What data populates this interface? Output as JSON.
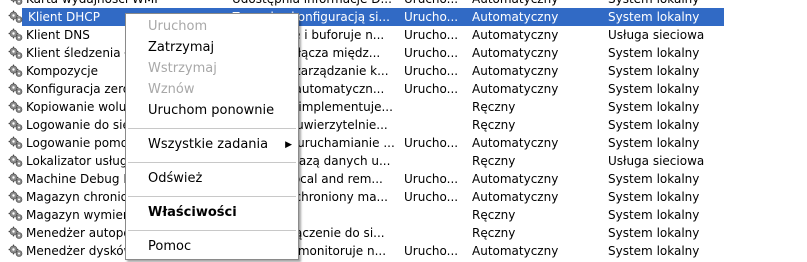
{
  "services": [
    {
      "name": "Karta wydajności WMI",
      "desc": "Udostępnia informacje D...",
      "status": "Urucho...",
      "startup": "Automatyczny",
      "logon": "System lokalny"
    },
    {
      "name": "Klient DHCP",
      "desc": "Zarządza konfiguracją si...",
      "status": "Urucho...",
      "startup": "Automatyczny",
      "logon": "System lokalny",
      "selected": true
    },
    {
      "name": "Klient DNS",
      "desc": "Rozpoznaje i buforuje n...",
      "status": "Urucho...",
      "startup": "Automatyczny",
      "logon": "Usługa sieciowa"
    },
    {
      "name": "Klient śledzenia łączy",
      "desc": "Utrzymuje łącza międz...",
      "status": "Urucho...",
      "startup": "Automatyczny",
      "logon": "System lokalny"
    },
    {
      "name": "Kompozycje",
      "desc": "Zapewnia zarządzanie k...",
      "status": "Urucho...",
      "startup": "Automatyczny",
      "logon": "System lokalny"
    },
    {
      "name": "Konfiguracja zerowej sieci",
      "desc": "Zapewnia automatyczn...",
      "status": "Urucho...",
      "startup": "Automatyczny",
      "logon": "System lokalny"
    },
    {
      "name": "Kopiowanie woluminów",
      "desc": "Zarządza i implementuje...",
      "status": "",
      "startup": "Ręczny",
      "logon": "System lokalny"
    },
    {
      "name": "Logowanie do sieci",
      "desc": "Obsługuje uwierzytelnie...",
      "status": "",
      "startup": "Ręczny",
      "logon": "System lokalny"
    },
    {
      "name": "Logowanie pomocnicze",
      "desc": "Umożliwia uruchamianie ...",
      "status": "Urucho...",
      "startup": "Automatyczny",
      "logon": "System lokalny"
    },
    {
      "name": "Lokalizator usługi RPC",
      "desc": "Zarządza bazą danych u...",
      "status": "",
      "startup": "Ręczny",
      "logon": "Usługa sieciowa"
    },
    {
      "name": "Machine Debug Manager",
      "desc": "Supports local and rem...",
      "status": "Urucho...",
      "startup": "Automatyczny",
      "logon": "System lokalny"
    },
    {
      "name": "Magazyn chroniony",
      "desc": "Zapewnia chroniony ma...",
      "status": "Urucho...",
      "startup": "Automatyczny",
      "logon": "System lokalny"
    },
    {
      "name": "Magazyn wymienny",
      "desc": "",
      "status": "",
      "startup": "Ręczny",
      "logon": "System lokalny"
    },
    {
      "name": "Menedżer autopołączeń",
      "desc": "Tworzy połączenie do si...",
      "status": "",
      "startup": "Ręczny",
      "logon": "System lokalny"
    },
    {
      "name": "Menedżer dysków logicznych",
      "desc": "Wykrywa i monitoruje n...",
      "status": "Urucho...",
      "startup": "Automatyczny",
      "logon": "System lokalny"
    }
  ],
  "context_menu": {
    "items": [
      {
        "label": "Uruchom",
        "disabled": true
      },
      {
        "label": "Zatrzymaj"
      },
      {
        "label": "Wstrzymaj",
        "disabled": true
      },
      {
        "label": "Wznów",
        "disabled": true
      },
      {
        "label": "Uruchom ponownie"
      },
      {
        "separator": true
      },
      {
        "label": "Wszystkie zadania",
        "submenu": true
      },
      {
        "separator": true
      },
      {
        "label": "Odśwież"
      },
      {
        "separator": true
      },
      {
        "label": "Właściwości",
        "bold": true
      },
      {
        "separator": true
      },
      {
        "label": "Pomoc"
      }
    ]
  },
  "colors": {
    "selection": "#316ac5",
    "disabled_text": "#a8a8a8"
  },
  "icons": {
    "service": "gear-icon",
    "submenu": "submenu-arrow-icon"
  }
}
